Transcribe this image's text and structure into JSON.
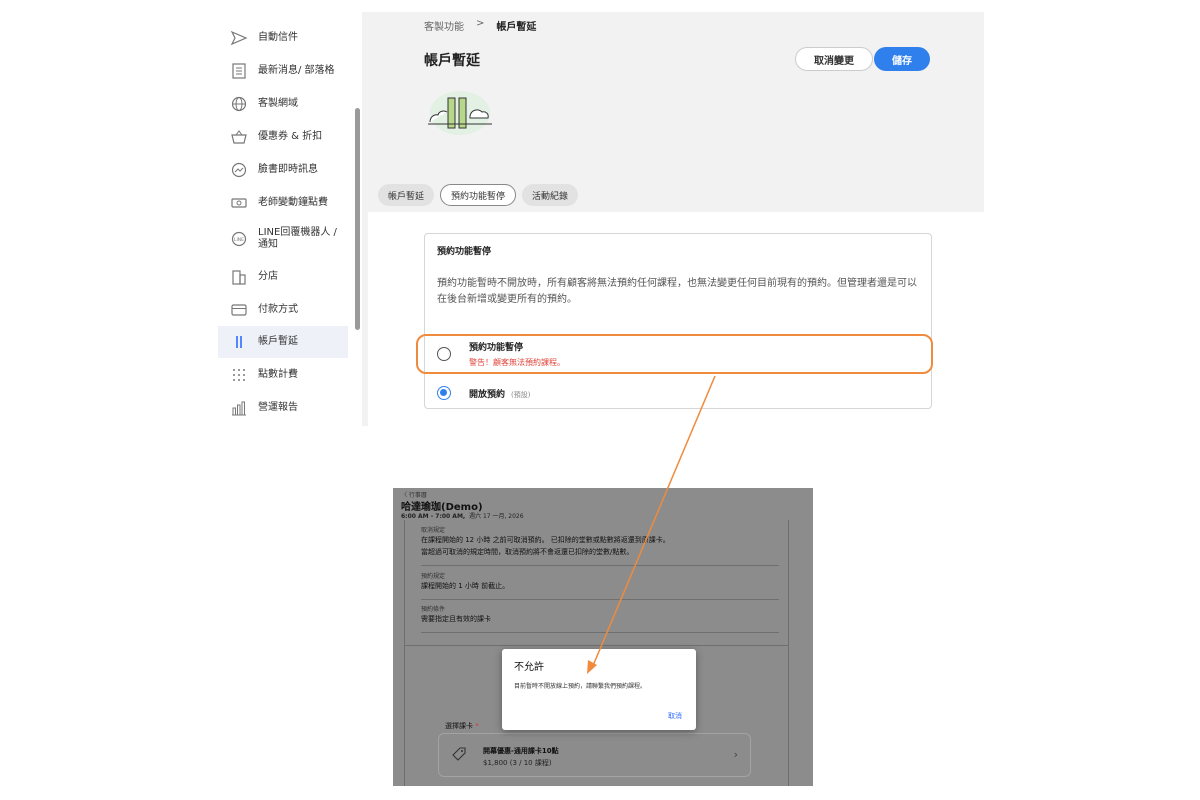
{
  "sidebar": {
    "items": [
      {
        "label": "自動信件",
        "icon": "send-icon"
      },
      {
        "label": "最新消息/ 部落格",
        "icon": "newspaper-icon"
      },
      {
        "label": "客製網域",
        "icon": "globe-icon"
      },
      {
        "label": "優惠券 & 折扣",
        "icon": "basket-icon"
      },
      {
        "label": "臉書即時訊息",
        "icon": "messenger-icon"
      },
      {
        "label": "老師變動鐘點費",
        "icon": "money-icon"
      },
      {
        "label": "LINE回覆機器人 / 通知",
        "icon": "line-icon"
      },
      {
        "label": "分店",
        "icon": "building-icon"
      },
      {
        "label": "付款方式",
        "icon": "credit-card-icon"
      },
      {
        "label": "帳戶暫延",
        "icon": "pause-icon"
      },
      {
        "label": "點數計費",
        "icon": "dots-grid-icon"
      },
      {
        "label": "營運報告",
        "icon": "bar-chart-icon"
      }
    ],
    "active_index": 9
  },
  "header": {
    "breadcrumb_parent": "客製功能",
    "breadcrumb_separator": ">",
    "breadcrumb_current": "帳戶暫延",
    "title": "帳戶暫延",
    "cancel_label": "取消變更",
    "save_label": "儲存"
  },
  "tabs": [
    {
      "label": "帳戶暫延"
    },
    {
      "label": "預約功能暫停"
    },
    {
      "label": "活動紀錄"
    }
  ],
  "active_tab": 1,
  "card": {
    "title": "預約功能暫停",
    "description": "預約功能暫時不開放時，所有顧客將無法預約任何課程，也無法變更任何目前現有的預約。但管理者還是可以在後台新增或變更所有的預約。",
    "options": [
      {
        "label": "預約功能暫停",
        "warning": "警告！顧客無法預約課程。",
        "selected": false
      },
      {
        "label": "開放預約",
        "sub": "(預設)",
        "selected": true
      }
    ]
  },
  "annotation": {
    "highlight_color": "#f08a3c",
    "arrow_color": "#f08a3c"
  },
  "booking": {
    "back_label": "〈  行事曆",
    "title": "哈達瑜珈(Demo)",
    "time_bold": "6:00 AM - 7:00 AM,",
    "date": "週六 17 一月, 2026",
    "sections": [
      {
        "heading": "取消規定",
        "lines": [
          "在課程開始的 12 小時 之前可取消預約。 已扣除的堂數或點數將返還到原課卡。",
          "當超過可取消的規定時間，取消預約將不會返還已扣除的堂數/點數。"
        ]
      },
      {
        "heading": "預約規定",
        "lines": [
          "課程開始的 1 小時 前截止。"
        ]
      },
      {
        "heading": "預約條件",
        "lines": [
          "需要指定且有效的課卡"
        ]
      }
    ],
    "choose_label": "選擇課卡",
    "required_mark": "*",
    "pass_name": "開幕優惠-通用課卡10點",
    "pass_price": "$1,800  (3 / 10  課程)"
  },
  "dialog": {
    "title": "不允許",
    "message": "目前暫時不開放線上預約，請聯繫我們預約課程。",
    "cancel_label": "取消"
  }
}
